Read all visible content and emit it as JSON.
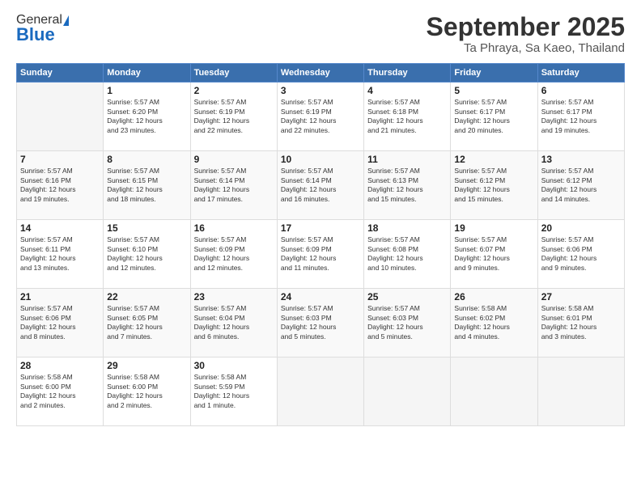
{
  "logo": {
    "general": "General",
    "blue": "Blue"
  },
  "header": {
    "month": "September 2025",
    "location": "Ta Phraya, Sa Kaeo, Thailand"
  },
  "days_of_week": [
    "Sunday",
    "Monday",
    "Tuesday",
    "Wednesday",
    "Thursday",
    "Friday",
    "Saturday"
  ],
  "weeks": [
    [
      {
        "day": "",
        "info": ""
      },
      {
        "day": "1",
        "info": "Sunrise: 5:57 AM\nSunset: 6:20 PM\nDaylight: 12 hours\nand 23 minutes."
      },
      {
        "day": "2",
        "info": "Sunrise: 5:57 AM\nSunset: 6:19 PM\nDaylight: 12 hours\nand 22 minutes."
      },
      {
        "day": "3",
        "info": "Sunrise: 5:57 AM\nSunset: 6:19 PM\nDaylight: 12 hours\nand 22 minutes."
      },
      {
        "day": "4",
        "info": "Sunrise: 5:57 AM\nSunset: 6:18 PM\nDaylight: 12 hours\nand 21 minutes."
      },
      {
        "day": "5",
        "info": "Sunrise: 5:57 AM\nSunset: 6:17 PM\nDaylight: 12 hours\nand 20 minutes."
      },
      {
        "day": "6",
        "info": "Sunrise: 5:57 AM\nSunset: 6:17 PM\nDaylight: 12 hours\nand 19 minutes."
      }
    ],
    [
      {
        "day": "7",
        "info": "Sunrise: 5:57 AM\nSunset: 6:16 PM\nDaylight: 12 hours\nand 19 minutes."
      },
      {
        "day": "8",
        "info": "Sunrise: 5:57 AM\nSunset: 6:15 PM\nDaylight: 12 hours\nand 18 minutes."
      },
      {
        "day": "9",
        "info": "Sunrise: 5:57 AM\nSunset: 6:14 PM\nDaylight: 12 hours\nand 17 minutes."
      },
      {
        "day": "10",
        "info": "Sunrise: 5:57 AM\nSunset: 6:14 PM\nDaylight: 12 hours\nand 16 minutes."
      },
      {
        "day": "11",
        "info": "Sunrise: 5:57 AM\nSunset: 6:13 PM\nDaylight: 12 hours\nand 15 minutes."
      },
      {
        "day": "12",
        "info": "Sunrise: 5:57 AM\nSunset: 6:12 PM\nDaylight: 12 hours\nand 15 minutes."
      },
      {
        "day": "13",
        "info": "Sunrise: 5:57 AM\nSunset: 6:12 PM\nDaylight: 12 hours\nand 14 minutes."
      }
    ],
    [
      {
        "day": "14",
        "info": "Sunrise: 5:57 AM\nSunset: 6:11 PM\nDaylight: 12 hours\nand 13 minutes."
      },
      {
        "day": "15",
        "info": "Sunrise: 5:57 AM\nSunset: 6:10 PM\nDaylight: 12 hours\nand 12 minutes."
      },
      {
        "day": "16",
        "info": "Sunrise: 5:57 AM\nSunset: 6:09 PM\nDaylight: 12 hours\nand 12 minutes."
      },
      {
        "day": "17",
        "info": "Sunrise: 5:57 AM\nSunset: 6:09 PM\nDaylight: 12 hours\nand 11 minutes."
      },
      {
        "day": "18",
        "info": "Sunrise: 5:57 AM\nSunset: 6:08 PM\nDaylight: 12 hours\nand 10 minutes."
      },
      {
        "day": "19",
        "info": "Sunrise: 5:57 AM\nSunset: 6:07 PM\nDaylight: 12 hours\nand 9 minutes."
      },
      {
        "day": "20",
        "info": "Sunrise: 5:57 AM\nSunset: 6:06 PM\nDaylight: 12 hours\nand 9 minutes."
      }
    ],
    [
      {
        "day": "21",
        "info": "Sunrise: 5:57 AM\nSunset: 6:06 PM\nDaylight: 12 hours\nand 8 minutes."
      },
      {
        "day": "22",
        "info": "Sunrise: 5:57 AM\nSunset: 6:05 PM\nDaylight: 12 hours\nand 7 minutes."
      },
      {
        "day": "23",
        "info": "Sunrise: 5:57 AM\nSunset: 6:04 PM\nDaylight: 12 hours\nand 6 minutes."
      },
      {
        "day": "24",
        "info": "Sunrise: 5:57 AM\nSunset: 6:03 PM\nDaylight: 12 hours\nand 5 minutes."
      },
      {
        "day": "25",
        "info": "Sunrise: 5:57 AM\nSunset: 6:03 PM\nDaylight: 12 hours\nand 5 minutes."
      },
      {
        "day": "26",
        "info": "Sunrise: 5:58 AM\nSunset: 6:02 PM\nDaylight: 12 hours\nand 4 minutes."
      },
      {
        "day": "27",
        "info": "Sunrise: 5:58 AM\nSunset: 6:01 PM\nDaylight: 12 hours\nand 3 minutes."
      }
    ],
    [
      {
        "day": "28",
        "info": "Sunrise: 5:58 AM\nSunset: 6:00 PM\nDaylight: 12 hours\nand 2 minutes."
      },
      {
        "day": "29",
        "info": "Sunrise: 5:58 AM\nSunset: 6:00 PM\nDaylight: 12 hours\nand 2 minutes."
      },
      {
        "day": "30",
        "info": "Sunrise: 5:58 AM\nSunset: 5:59 PM\nDaylight: 12 hours\nand 1 minute."
      },
      {
        "day": "",
        "info": ""
      },
      {
        "day": "",
        "info": ""
      },
      {
        "day": "",
        "info": ""
      },
      {
        "day": "",
        "info": ""
      }
    ]
  ]
}
